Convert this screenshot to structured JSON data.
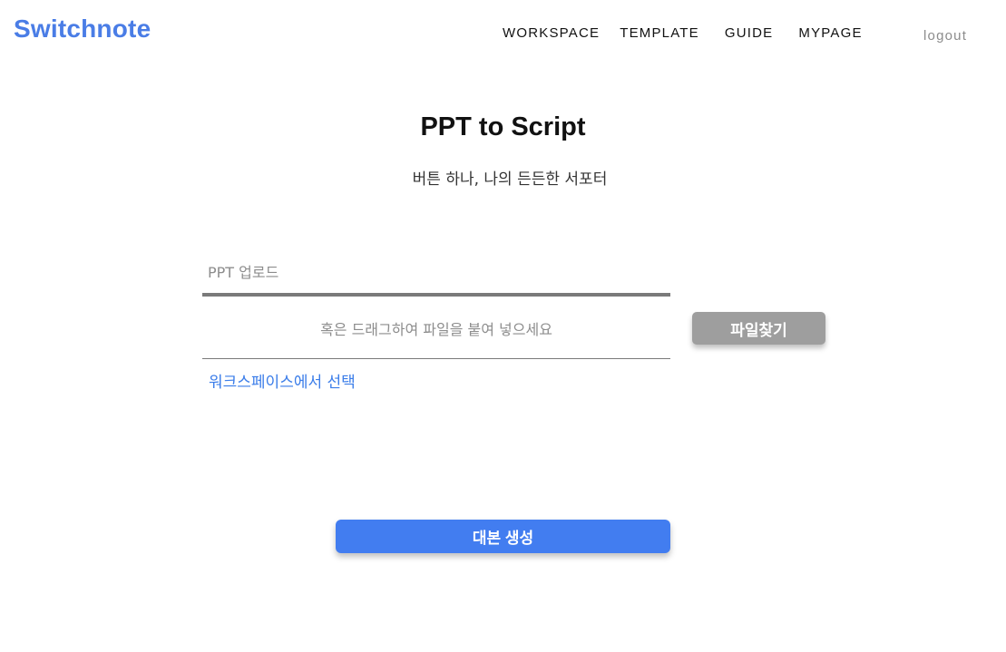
{
  "header": {
    "logo": "Switchnote",
    "nav": {
      "workspace": "WORKSPACE",
      "template": "TEMPLATE",
      "guide": "GUIDE",
      "mypage": "MYPAGE"
    },
    "logout": "logout"
  },
  "hero": {
    "title": "PPT to Script",
    "subtitle": "버튼 하나, 나의 든든한 서포터"
  },
  "upload": {
    "label": "PPT 업로드",
    "dropzone_text": "혹은 드래그하여 파일을 붙여 넣으세요",
    "find_file_label": "파일찾기",
    "workspace_link": "워크스페이스에서 선택"
  },
  "actions": {
    "generate_label": "대본 생성"
  },
  "colors": {
    "brand": "#4a7de6",
    "primary_button": "#427df0",
    "secondary_button": "#9e9e9e",
    "link": "#3b7de9"
  }
}
